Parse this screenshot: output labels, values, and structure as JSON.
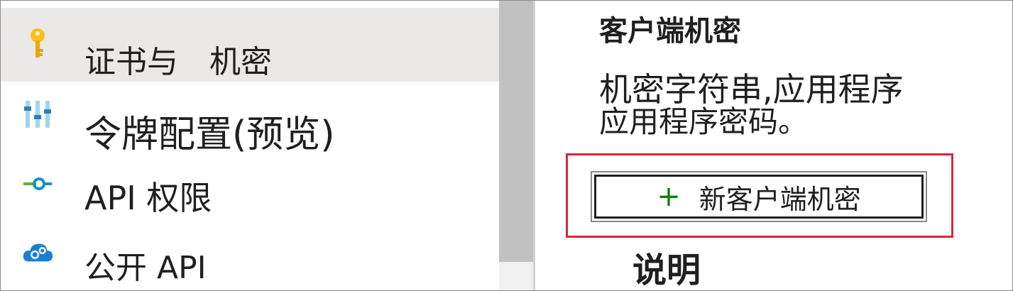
{
  "nav": {
    "items": [
      {
        "label": "证书与　机密",
        "icon": "key-icon",
        "selected": true
      },
      {
        "label": "令牌配置(预览)",
        "icon": "token-config-icon",
        "selected": false
      },
      {
        "label": "API 权限",
        "icon": "api-permissions-icon",
        "selected": false
      },
      {
        "label": "公开 API",
        "icon": "cloud-gear-icon",
        "selected": false
      }
    ]
  },
  "content": {
    "section_title": "客户端机密",
    "description_line1": "机密字符串,应用程序",
    "description_line2": "应用程序密码。",
    "new_secret_button": {
      "icon": "plus-icon",
      "label": "新客户端机密"
    },
    "column_header": "说明"
  },
  "colors": {
    "selected_bg": "#ebe9e8",
    "highlight_border": "#d6283a",
    "plus": "#107c10"
  }
}
